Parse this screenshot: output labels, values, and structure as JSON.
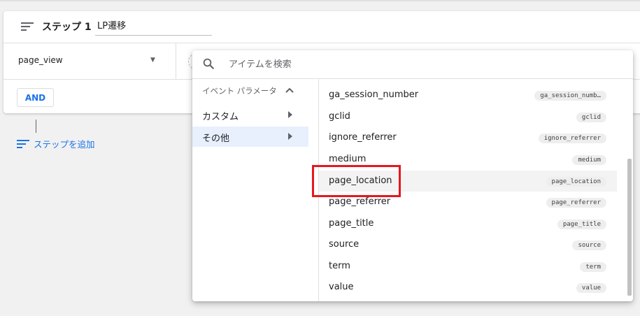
{
  "step": {
    "title": "ステップ 1",
    "name_value": "LP遷移",
    "event_value": "page_view",
    "and_label": "AND"
  },
  "add_step_label": "ステップを追加",
  "dropdown": {
    "search_placeholder": "アイテムを検索",
    "category_header": "イベント パラメータ",
    "categories": [
      {
        "label": "カスタム",
        "selected": false
      },
      {
        "label": "その他",
        "selected": true
      }
    ],
    "params": [
      {
        "name": "ga_session_number",
        "chip": "ga_session_numb…"
      },
      {
        "name": "gclid",
        "chip": "gclid"
      },
      {
        "name": "ignore_referrer",
        "chip": "ignore_referrer"
      },
      {
        "name": "medium",
        "chip": "medium"
      },
      {
        "name": "page_location",
        "chip": "page_location",
        "highlighted": true
      },
      {
        "name": "page_referrer",
        "chip": "page_referrer"
      },
      {
        "name": "page_title",
        "chip": "page_title"
      },
      {
        "name": "source",
        "chip": "source"
      },
      {
        "name": "term",
        "chip": "term"
      },
      {
        "name": "value",
        "chip": "value"
      }
    ]
  },
  "colors": {
    "accent": "#1a73e8",
    "annotation": "#e8171e",
    "selected_bg": "#e8f0fe"
  }
}
